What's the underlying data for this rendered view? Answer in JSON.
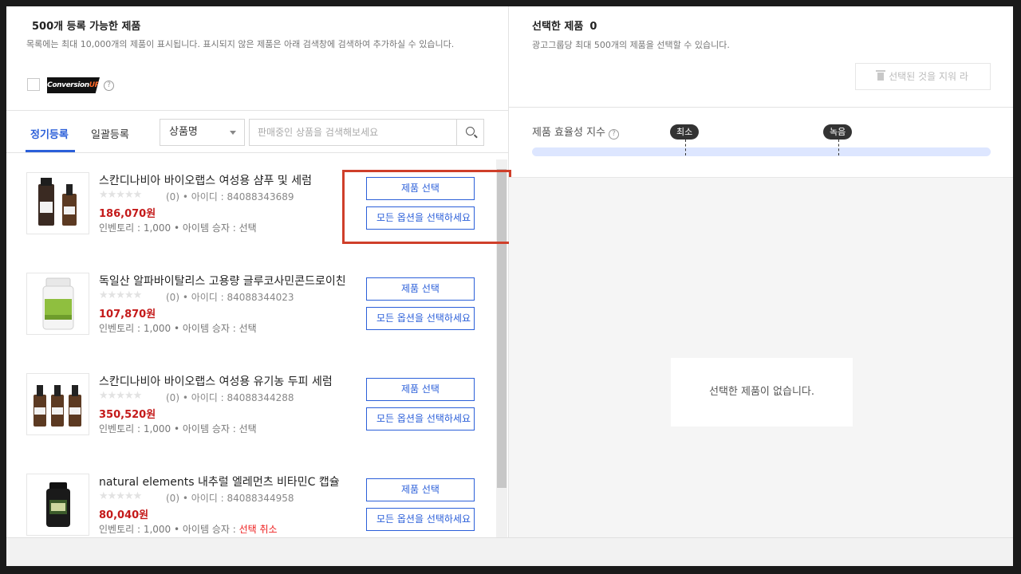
{
  "left": {
    "title": "500개 등록 가능한 제품",
    "desc": "목록에는 최대 10,000개의 제품이 표시됩니다. 표시되지 않은 제품은 아래 검색창에 검색하여 추가하실 수 있습니다.",
    "badge_main": "Conversion",
    "badge_accent": "UP",
    "help": "?",
    "tabs": [
      "정기등록",
      "일괄등록"
    ],
    "select_value": "상품명",
    "search_placeholder": "판매중인 상품을 검색해보세요"
  },
  "products": [
    {
      "name": "스칸디나비아 바이오랩스 여성용 샴푸 및 세럼",
      "stars": "★★★★★",
      "meta": "(0) • 아이디 : 84088343689",
      "price": "186,070원",
      "inventory": "인벤토리 : 1,000 • 아이템 승자 : ",
      "status": "선택",
      "btn_select": "제품 선택",
      "btn_options": "모든 옵션을 선택하세요"
    },
    {
      "name": "독일산 알파바이탈리스 고용량 글루코사민콘드로이친",
      "stars": "★★★★★",
      "meta": "(0) • 아이디 : 84088344023",
      "price": "107,870원",
      "inventory": "인벤토리 : 1,000 • 아이템 승자 : ",
      "status": "선택",
      "btn_select": "제품 선택",
      "btn_options": "모든 옵션을 선택하세요"
    },
    {
      "name": "스칸디나비아 바이오랩스 여성용 유기농 두피 세럼",
      "stars": "★★★★★",
      "meta": "(0) • 아이디 : 84088344288",
      "price": "350,520원",
      "inventory": "인벤토리 : 1,000 • 아이템 승자 : ",
      "status": "선택",
      "btn_select": "제품 선택",
      "btn_options": "모든 옵션을 선택하세요"
    },
    {
      "name": "natural elements 내추럴 엘레먼츠 비타민C 캡슐",
      "stars": "★★★★★",
      "meta": "(0) • 아이디 : 84088344958",
      "price": "80,040원",
      "inventory": "인벤토리 : 1,000 • 아이템 승자 : ",
      "status": "선택 취소",
      "btn_select": "제품 선택",
      "btn_options": "모든 옵션을 선택하세요"
    }
  ],
  "right": {
    "title": "선택한 제품",
    "count": "0",
    "desc": "광고그룹당 최대 500개의 제품을 선택할 수 있습니다.",
    "clear_label": "선택된 것을 지워 라",
    "efficiency_label": "제품 효율성 지수",
    "marker_min": "최소",
    "marker_green": "녹음",
    "empty_text": "선택한 제품이 없습니다."
  },
  "colors": {
    "accent": "#2b5fd9",
    "price": "#c41a1a",
    "highlight": "#cf3f2a"
  }
}
